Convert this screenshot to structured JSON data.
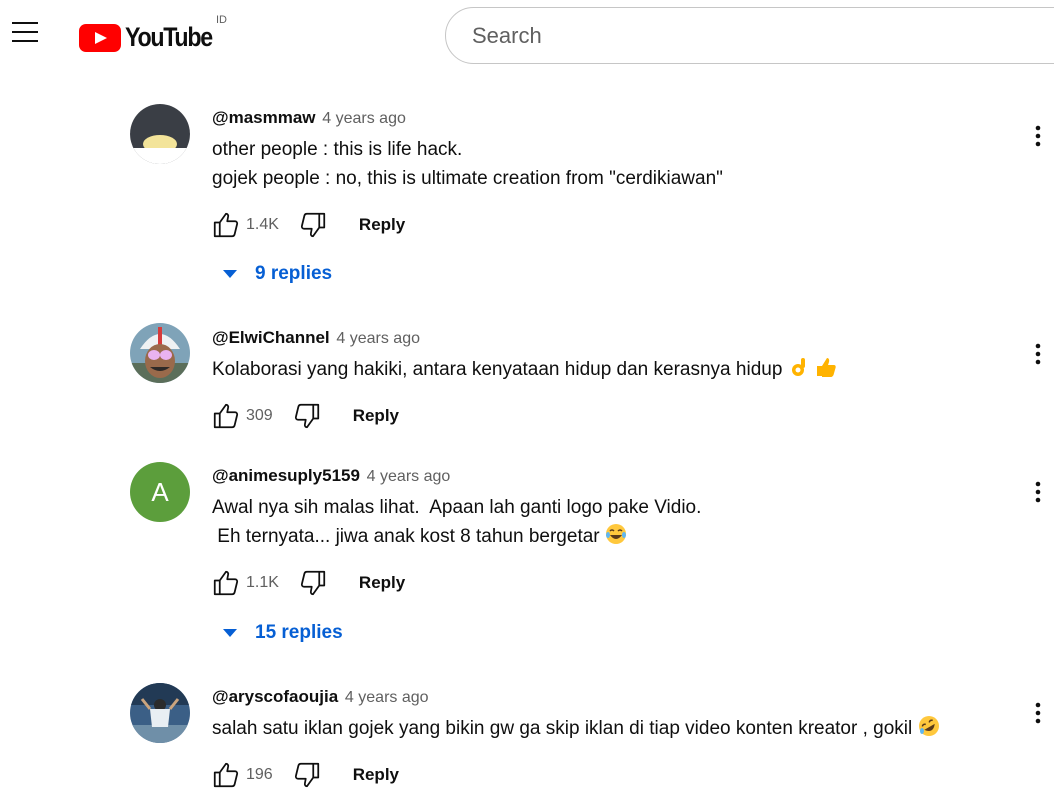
{
  "header": {
    "logo_text": "YouTube",
    "region": "ID",
    "search_placeholder": "Search"
  },
  "comments": [
    {
      "author": "@masmmaw",
      "time": "4 years ago",
      "lines": [
        "other people : this is life hack.",
        "gojek people : no, this is ultimate creation from \"cerdikiawan\""
      ],
      "likes": "1.4K",
      "reply_label": "Reply",
      "replies_label": "9 replies"
    },
    {
      "author": "@ElwiChannel",
      "time": "4 years ago",
      "lines": [
        "Kolaborasi yang hakiki, antara kenyataan hidup dan kerasnya hidup "
      ],
      "emojis": [
        "ok-hand-emoji",
        "thumbs-up-emoji"
      ],
      "likes": "309",
      "reply_label": "Reply"
    },
    {
      "author": "@animesuply5159",
      "time": "4 years ago",
      "avatar_letter": "A",
      "avatar_color": "#5c9e3c",
      "lines": [
        "Awal nya sih malas lihat.  Apaan lah ganti logo pake Vidio.",
        " Eh ternyata... jiwa anak kost 8 tahun bergetar "
      ],
      "emojis": [
        "tears-of-joy-emoji"
      ],
      "likes": "1.1K",
      "reply_label": "Reply",
      "replies_label": "15 replies"
    },
    {
      "author": "@aryscofaoujia",
      "time": "4 years ago",
      "lines": [
        "salah satu iklan gojek yang bikin gw ga skip iklan di tiap video konten kreator , gokil "
      ],
      "emojis": [
        "rolling-laughing-emoji"
      ],
      "likes": "196",
      "reply_label": "Reply"
    }
  ],
  "colors": {
    "brand_red": "#ff0000",
    "link_blue": "#065fd4",
    "secondary_text": "#606060"
  }
}
